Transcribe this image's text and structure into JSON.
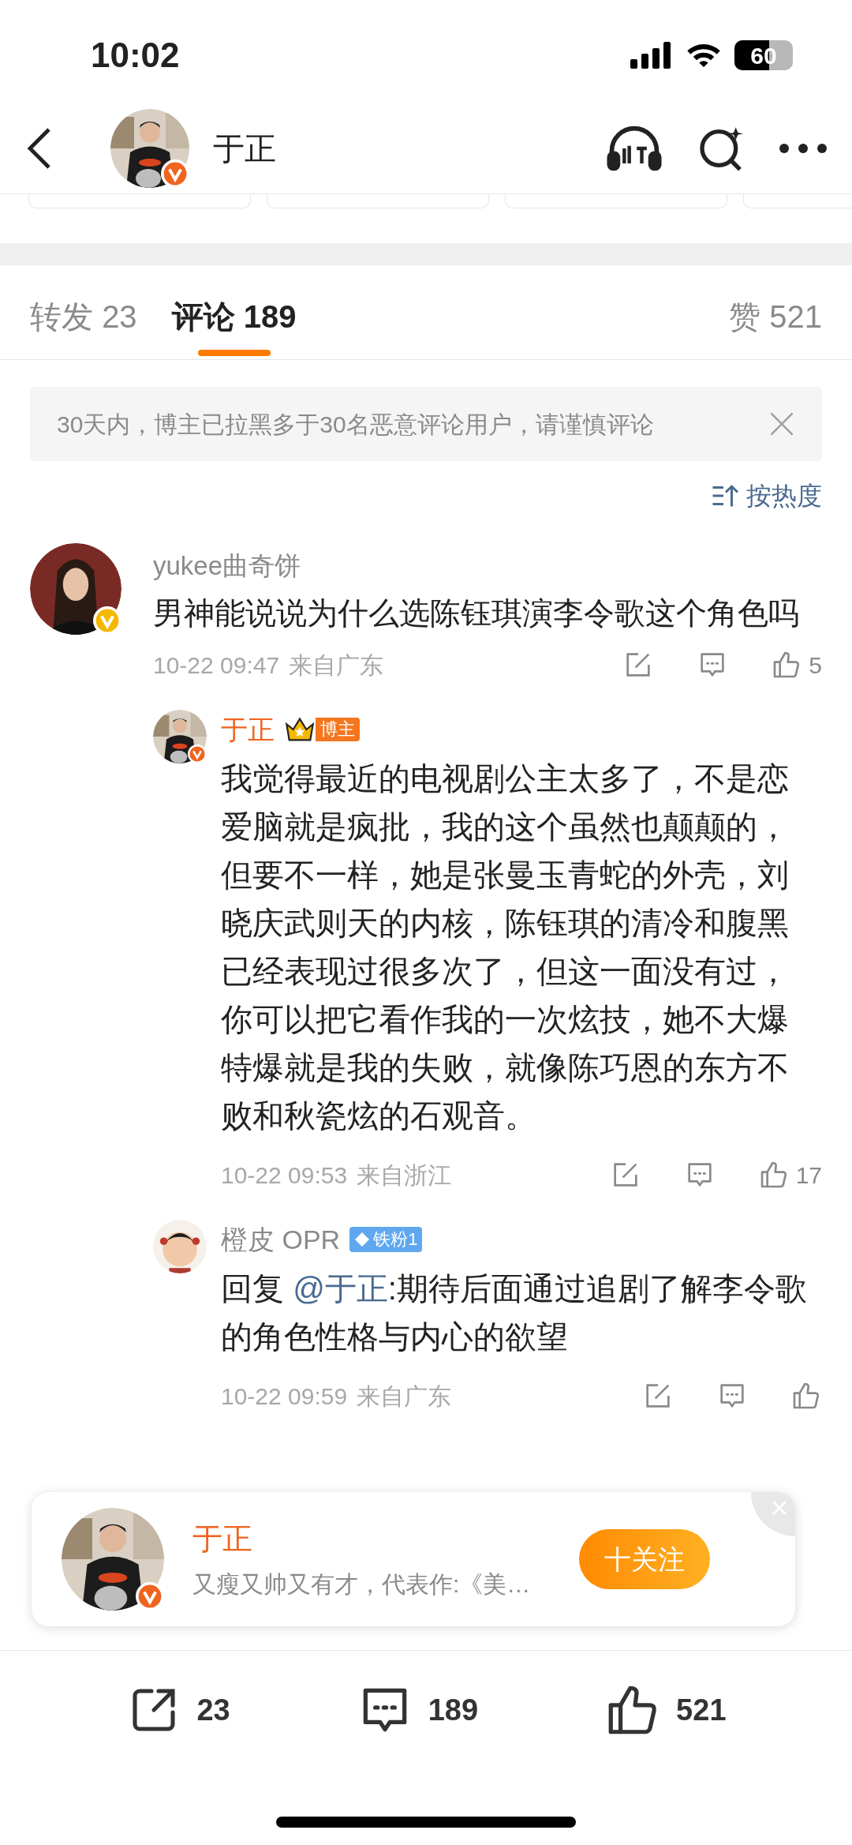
{
  "status_bar": {
    "time": "10:02",
    "battery": "60"
  },
  "header": {
    "title": "于正",
    "verified": true
  },
  "tabs": [
    {
      "label": "转发",
      "count": "23",
      "selected": false
    },
    {
      "label": "评论",
      "count": "189",
      "selected": true
    },
    {
      "label": "赞",
      "count": "521",
      "selected": false
    }
  ],
  "notice": {
    "text": "30天内，博主已拉黑多于30名恶意评论用户，请谨慎评论"
  },
  "sort": {
    "label": "按热度"
  },
  "comments": [
    {
      "user": "yukee曲奇饼",
      "verified": true,
      "text": "男神能说说为什么选陈钰琪演李令歌这个角色吗",
      "time": "10-22 09:47",
      "location": "来自广东",
      "likes": "5",
      "replies": [
        {
          "user": "于正",
          "author": true,
          "verified": true,
          "badge": {
            "kind": "owner",
            "label": "博主"
          },
          "text": "我觉得最近的电视剧公主太多了，不是恋爱脑就是疯批，我的这个虽然也颠颠的，但要不一样，她是张曼玉青蛇的外壳，刘晓庆武则天的内核，陈钰琪的清冷和腹黑已经表现过很多次了，但这一面没有过，你可以把它看作我的一次炫技，她不大爆特爆就是我的失败，就像陈巧恩的东方不败和秋瓷炫的石观音。",
          "time": "10-22 09:53",
          "location": "来自浙江",
          "likes": "17"
        },
        {
          "user": "橙皮 OPR",
          "author": false,
          "badge": {
            "kind": "fan",
            "label": "铁粉1"
          },
          "reply_prefix": "回复",
          "mention": "@于正",
          "text": ":期待后面通过追剧了解李令歌的角色性格与内心的欲望",
          "time": "10-22 09:59",
          "location": "来自广东"
        }
      ]
    }
  ],
  "follow_popup": {
    "name": "于正",
    "bio": "又瘦又帅又有才，代表作:《美…",
    "button": "十关注"
  },
  "bottom_bar": [
    {
      "kind": "repost",
      "count": "23"
    },
    {
      "kind": "comment",
      "count": "189"
    },
    {
      "kind": "like",
      "count": "521"
    }
  ]
}
